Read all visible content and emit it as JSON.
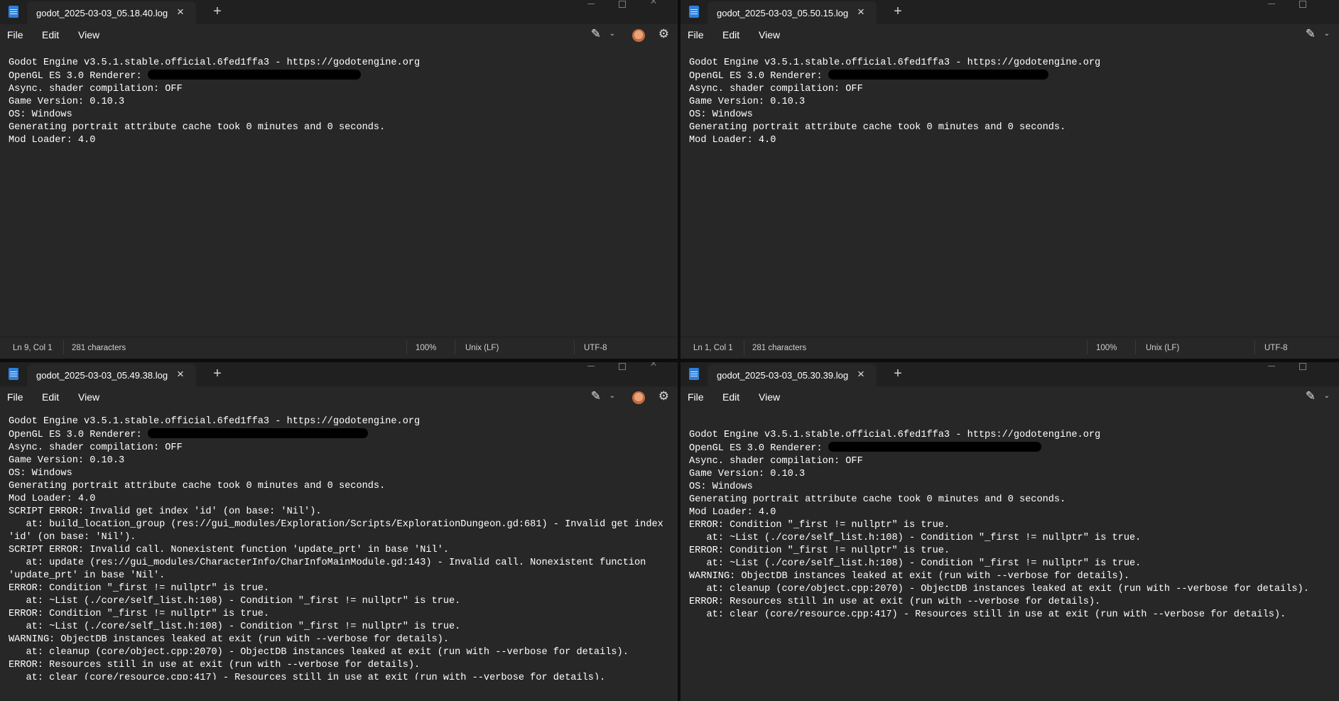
{
  "menu": {
    "file": "File",
    "edit": "Edit",
    "view": "View"
  },
  "windows": [
    {
      "tab_title": "godot_2025-03-03_05.18.40.log",
      "lines": [
        "Godot Engine v3.5.1.stable.official.6fed1ffa3 - https://godotengine.org",
        "OpenGL ES 3.0 Renderer:",
        "Async. shader compilation: OFF",
        "",
        "Game Version: 0.10.3",
        "OS: Windows",
        "Generating portrait attribute cache took 0 minutes and 0 seconds.",
        "Mod Loader: 4.0"
      ],
      "status": {
        "position": "Ln 9, Col 1",
        "characters": "281 characters",
        "zoom": "100%",
        "line_endings": "Unix (LF)",
        "encoding": "UTF-8"
      }
    },
    {
      "tab_title": "godot_2025-03-03_05.50.15.log",
      "lines": [
        "Godot Engine v3.5.1.stable.official.6fed1ffa3 - https://godotengine.org",
        "OpenGL ES 3.0 Renderer:",
        "Async. shader compilation: OFF",
        "",
        "Game Version: 0.10.3",
        "OS: Windows",
        "Generating portrait attribute cache took 0 minutes and 0 seconds.",
        "Mod Loader: 4.0"
      ],
      "status": {
        "position": "Ln 1, Col 1",
        "characters": "281 characters",
        "zoom": "100%",
        "line_endings": "Unix (LF)",
        "encoding": "UTF-8"
      }
    },
    {
      "tab_title": "godot_2025-03-03_05.49.38.log",
      "lines": [
        "Godot Engine v3.5.1.stable.official.6fed1ffa3 - https://godotengine.org",
        "OpenGL ES 3.0 Renderer:",
        "Async. shader compilation: OFF",
        "",
        "Game Version: 0.10.3",
        "OS: Windows",
        "Generating portrait attribute cache took 0 minutes and 0 seconds.",
        "Mod Loader: 4.0",
        "SCRIPT ERROR: Invalid get index 'id' (on base: 'Nil').",
        "   at: build_location_group (res://gui_modules/Exploration/Scripts/ExplorationDungeon.gd:681) - Invalid get index",
        "'id' (on base: 'Nil').",
        "SCRIPT ERROR: Invalid call. Nonexistent function 'update_prt' in base 'Nil'.",
        "   at: update (res://gui_modules/CharacterInfo/CharInfoMainModule.gd:143) - Invalid call. Nonexistent function",
        "'update_prt' in base 'Nil'.",
        "ERROR: Condition \"_first != nullptr\" is true.",
        "   at: ~List (./core/self_list.h:108) - Condition \"_first != nullptr\" is true.",
        "ERROR: Condition \"_first != nullptr\" is true.",
        "   at: ~List (./core/self_list.h:108) - Condition \"_first != nullptr\" is true.",
        "WARNING: ObjectDB instances leaked at exit (run with --verbose for details).",
        "   at: cleanup (core/object.cpp:2070) - ObjectDB instances leaked at exit (run with --verbose for details).",
        "ERROR: Resources still in use at exit (run with --verbose for details).",
        "   at: clear (core/resource.cpp:417) - Resources still in use at exit (run with --verbose for details)."
      ]
    },
    {
      "tab_title": "godot_2025-03-03_05.30.39.log",
      "lines": [
        "Godot Engine v3.5.1.stable.official.6fed1ffa3 - https://godotengine.org",
        "OpenGL ES 3.0 Renderer:",
        "Async. shader compilation: OFF",
        "",
        "Game Version: 0.10.3",
        "OS: Windows",
        "Generating portrait attribute cache took 0 minutes and 0 seconds.",
        "Mod Loader: 4.0",
        "ERROR: Condition \"_first != nullptr\" is true.",
        "   at: ~List (./core/self_list.h:108) - Condition \"_first != nullptr\" is true.",
        "ERROR: Condition \"_first != nullptr\" is true.",
        "   at: ~List (./core/self_list.h:108) - Condition \"_first != nullptr\" is true.",
        "WARNING: ObjectDB instances leaked at exit (run with --verbose for details).",
        "   at: cleanup (core/object.cpp:2070) - ObjectDB instances leaked at exit (run with --verbose for details).",
        "ERROR: Resources still in use at exit (run with --verbose for details).",
        "   at: clear (core/resource.cpp:417) - Resources still in use at exit (run with --verbose for details)."
      ]
    }
  ]
}
